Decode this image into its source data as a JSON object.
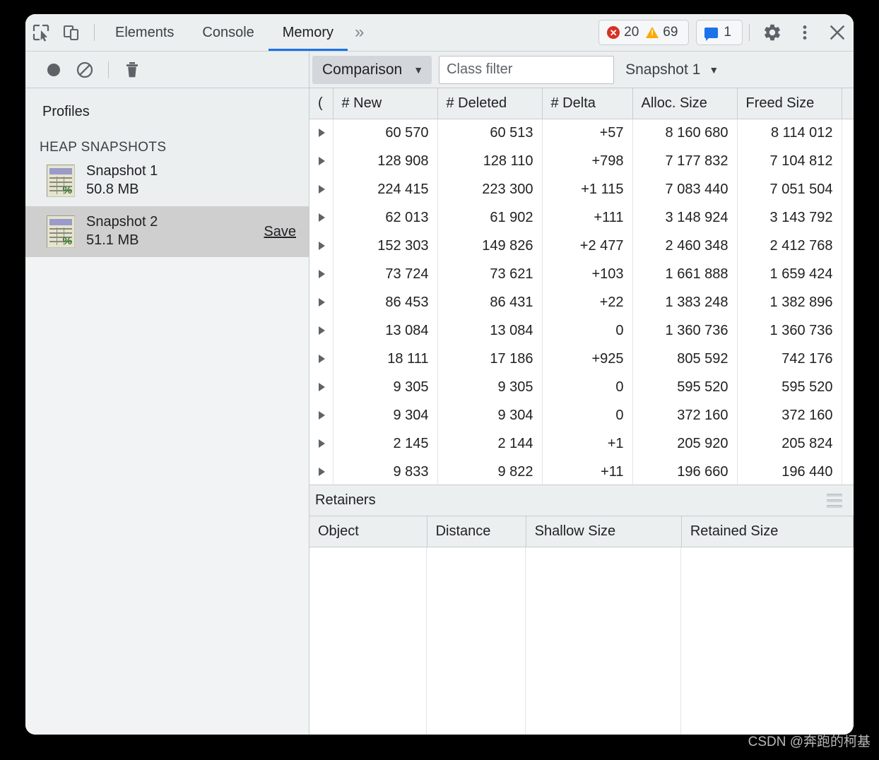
{
  "window": {
    "tabbar": {
      "inspect_icon": "inspect-element-icon",
      "device_icon": "device-toolbar-icon",
      "tabs": [
        {
          "label": "Elements",
          "selected": false
        },
        {
          "label": "Console",
          "selected": false
        },
        {
          "label": "Memory",
          "selected": true
        }
      ],
      "more_tabs": "»",
      "errors_count": "20",
      "warnings_count": "69",
      "messages_count": "1",
      "settings_icon": "gear-icon",
      "more_icon": "kebab-menu-icon",
      "close_icon": "close-icon",
      "accent_color": "#1a73e8",
      "error_color": "#d93025",
      "warning_color": "#f9ab00"
    }
  },
  "left_panel": {
    "toolbar": {
      "record_icon": "record-circle-icon",
      "clear_icon": "clear-no-entry-icon",
      "trash_icon": "trash-icon"
    },
    "profiles_title": "Profiles",
    "section_title": "HEAP SNAPSHOTS",
    "snapshots": [
      {
        "name": "Snapshot 1",
        "size": "50.8 MB",
        "selected": false,
        "save_label": ""
      },
      {
        "name": "Snapshot 2",
        "size": "51.1 MB",
        "selected": true,
        "save_label": "Save"
      }
    ]
  },
  "right_panel": {
    "toolbar": {
      "view_mode": "Comparison",
      "filter_placeholder": "Class filter",
      "filter_value": "",
      "base_snapshot": "Snapshot 1",
      "caret": "▼"
    },
    "constructors_table": {
      "columns": [
        "(",
        "# New",
        "# Deleted",
        "# Delta",
        "Alloc. Size",
        "Freed Size"
      ],
      "rows": [
        {
          "new": "60 570",
          "deleted": "60 513",
          "delta": "+57",
          "alloc": "8 160 680",
          "freed": "8 114 012"
        },
        {
          "new": "128 908",
          "deleted": "128 110",
          "delta": "+798",
          "alloc": "7 177 832",
          "freed": "7 104 812"
        },
        {
          "new": "224 415",
          "deleted": "223 300",
          "delta": "+1 115",
          "alloc": "7 083 440",
          "freed": "7 051 504"
        },
        {
          "new": "62 013",
          "deleted": "61 902",
          "delta": "+111",
          "alloc": "3 148 924",
          "freed": "3 143 792"
        },
        {
          "new": "152 303",
          "deleted": "149 826",
          "delta": "+2 477",
          "alloc": "2 460 348",
          "freed": "2 412 768"
        },
        {
          "new": "73 724",
          "deleted": "73 621",
          "delta": "+103",
          "alloc": "1 661 888",
          "freed": "1 659 424"
        },
        {
          "new": "86 453",
          "deleted": "86 431",
          "delta": "+22",
          "alloc": "1 383 248",
          "freed": "1 382 896"
        },
        {
          "new": "13 084",
          "deleted": "13 084",
          "delta": "0",
          "alloc": "1 360 736",
          "freed": "1 360 736"
        },
        {
          "new": "18 111",
          "deleted": "17 186",
          "delta": "+925",
          "alloc": "805 592",
          "freed": "742 176"
        },
        {
          "new": "9 305",
          "deleted": "9 305",
          "delta": "0",
          "alloc": "595 520",
          "freed": "595 520"
        },
        {
          "new": "9 304",
          "deleted": "9 304",
          "delta": "0",
          "alloc": "372 160",
          "freed": "372 160"
        },
        {
          "new": "2 145",
          "deleted": "2 144",
          "delta": "+1",
          "alloc": "205 920",
          "freed": "205 824"
        },
        {
          "new": "9 833",
          "deleted": "9 822",
          "delta": "+11",
          "alloc": "196 660",
          "freed": "196 440"
        }
      ]
    },
    "retainers": {
      "title": "Retainers",
      "menu_icon": "hamburger-icon",
      "columns": [
        "Object",
        "Distance",
        "Shallow Size",
        "Retained Size"
      ],
      "rows": []
    }
  },
  "watermark": "CSDN @奔跑的柯基"
}
